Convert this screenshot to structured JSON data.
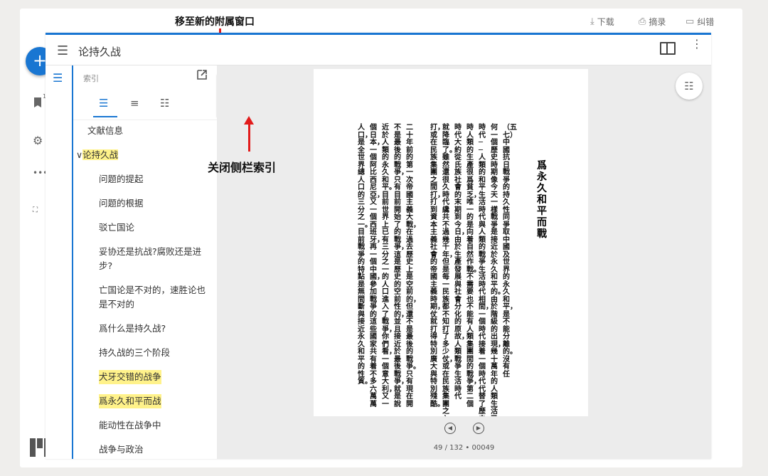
{
  "toplinks": {
    "download": "下载",
    "excerpt": "摘录",
    "correction": "纠错"
  },
  "annotations": {
    "popout": "移至新的附属窗口",
    "close_sidebar": "关闭侧栏索引"
  },
  "rail": {
    "fab": "+",
    "badge": "1"
  },
  "header": {
    "title": "论持久战"
  },
  "sidebar": {
    "panel_title": "索引",
    "items": [
      {
        "label": "文献信息"
      },
      {
        "label": "论持久战",
        "caret": "∨"
      },
      {
        "label": "问题的提起"
      },
      {
        "label": "问题的根据"
      },
      {
        "label": "驳亡国论"
      },
      {
        "label": "妥协还是抗战?腐败还是进步?"
      },
      {
        "label": "亡国论是不对的，速胜论也是不对的"
      },
      {
        "label": "爲什么是持久战?"
      },
      {
        "label": "持久战的三个阶段"
      },
      {
        "label": "犬牙交错的战争"
      },
      {
        "label": "爲永久和平而战"
      },
      {
        "label": "能动性在战争中"
      },
      {
        "label": "战争与政治"
      }
    ]
  },
  "viewer": {
    "page_info": "49 / 132 • 00049",
    "page_title": "爲永久和平而戰",
    "page_subtitle": "（五七）",
    "columns": [
      "（五七）中國抗日戰爭的持久性同爭取中國及世界的永久和平，是不能分離的。沒有任",
      "何一個歷史時期像今天一樣戰爭是接近於永久和平的。由於階級的出現，幾十萬年的人類生活已經過去了好幾",
      "時代──人類的和平生活時代與人類的戰爭生活時代相間，一個時代接着一個時代代替了歷史的最長時期。戰",
      "時人類的生產很爲貧乏，唯一的是向着自然作戰。不需要也不能有人類集團間的戰爭，第二個",
      "時代大約從氏族社會的末期到今日，由於生產發展與社會分化的原故，人類戰爭生活時代",
      "就降臨了。雖然還很久時代纔共不過幾千年，但是每一民族都不知打了多少仗，或在民族集團之內，",
      "打，或在民族集團之間打，打到資本主義社會的帝國主義時期，仗就打得特別廣大與特別殘酷。",
      "二十年前的第一次帝國主義大戰，在過去歷史上是空前的，但還不是最後的戰爭。只有現在開",
      "不是最後的戰爭，只有目前開始了的戰爭，這是歷史的空前性的，並且接近於最後戰爭，就是說",
      "近於人類的永久和平。目前世界上已有三分之一的人口進入了戰爭，你們看，一個意大利，又一",
      "個日本，一個阿比西尼亞，又一個西班牙，再一個中國，參加戰爭的這些國家共有着不多六萬萬",
      "人口，是全世界總人口的三分之一。目前戰爭的特點是無間斷與接近永久和平的性質。"
    ]
  }
}
